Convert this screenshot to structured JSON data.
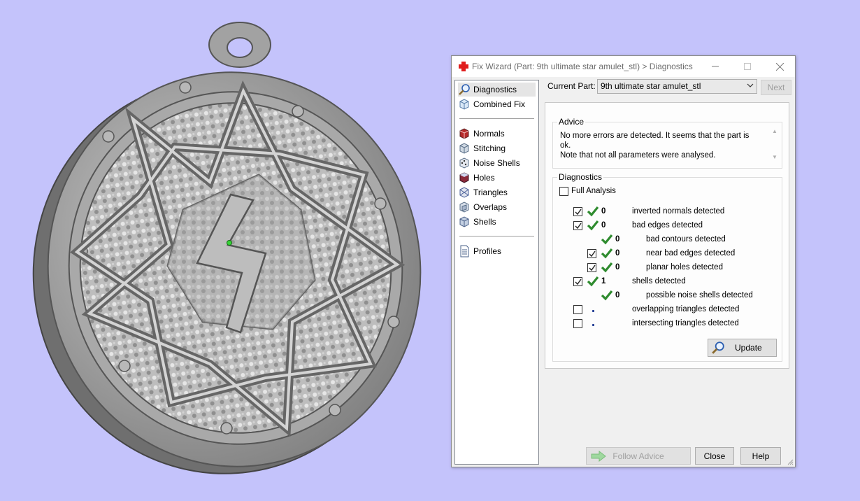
{
  "window": {
    "title": "Fix Wizard (Part: 9th ultimate star amulet_stl) > Diagnostics",
    "icon": "red-cross-icon"
  },
  "nav": {
    "items": [
      {
        "label": "Diagnostics",
        "icon": "magnifier-icon",
        "selected": true
      },
      {
        "label": "Combined Fix",
        "icon": "cube-icon"
      },
      {
        "label": "Normals",
        "icon": "normals-cube-icon"
      },
      {
        "label": "Stitching",
        "icon": "stitching-cube-icon"
      },
      {
        "label": "Noise Shells",
        "icon": "noise-shells-cube-icon"
      },
      {
        "label": "Holes",
        "icon": "holes-cube-icon"
      },
      {
        "label": "Triangles",
        "icon": "triangles-cube-icon"
      },
      {
        "label": "Overlaps",
        "icon": "overlaps-cube-icon"
      },
      {
        "label": "Shells",
        "icon": "shells-cube-icon"
      },
      {
        "label": "Profiles",
        "icon": "document-icon"
      }
    ]
  },
  "header": {
    "current_part_label": "Current Part:",
    "current_part_value": "9th ultimate star amulet_stl",
    "next_label": "Next"
  },
  "advice": {
    "title": "Advice",
    "line1": "No more errors are detected. It seems that the part is ok.",
    "line2": "Note that not all parameters were analysed."
  },
  "diagnostics": {
    "title": "Diagnostics",
    "full_analysis_label": "Full Analysis",
    "full_analysis_checked": false,
    "rows": [
      {
        "checked": true,
        "status": "ok",
        "count": "0",
        "label": "inverted normals detected",
        "indent": 0
      },
      {
        "checked": true,
        "status": "ok",
        "count": "0",
        "label": "bad edges detected",
        "indent": 0
      },
      {
        "checked": null,
        "status": "ok",
        "count": "0",
        "label": "bad contours detected",
        "indent": 1
      },
      {
        "checked": true,
        "status": "ok",
        "count": "0",
        "label": "near bad edges detected",
        "indent": 1
      },
      {
        "checked": true,
        "status": "ok",
        "count": "0",
        "label": "planar holes detected",
        "indent": 1
      },
      {
        "checked": true,
        "status": "ok",
        "count": "1",
        "label": "shells detected",
        "indent": 0
      },
      {
        "checked": null,
        "status": "ok",
        "count": "0",
        "label": "possible noise shells detected",
        "indent": 1
      },
      {
        "checked": false,
        "status": "pending",
        "count": "",
        "label": "overlapping triangles detected",
        "indent": 0
      },
      {
        "checked": false,
        "status": "pending",
        "count": "",
        "label": "intersecting triangles detected",
        "indent": 0
      }
    ],
    "update_label": "Update"
  },
  "footer": {
    "follow_advice_label": "Follow Advice",
    "close_label": "Close",
    "help_label": "Help"
  },
  "colors": {
    "background": "#c4c3fb",
    "model": "#9a9a9a",
    "check_green": "#2e8b2e"
  }
}
